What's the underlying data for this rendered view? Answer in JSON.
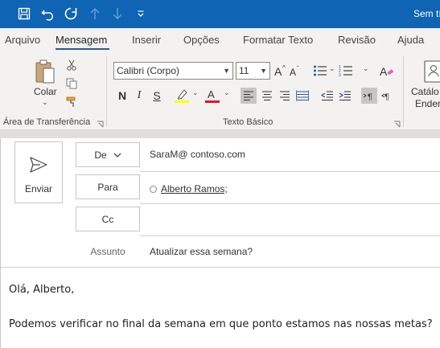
{
  "window": {
    "title": "Sem tí"
  },
  "quick_access": {
    "icons": [
      "save-icon",
      "undo-icon",
      "redo-icon",
      "arrow-up-icon",
      "arrow-down-icon",
      "customize-icon"
    ]
  },
  "tabs": [
    {
      "label": "Arquivo",
      "active": false
    },
    {
      "label": "Mensagem",
      "active": true
    },
    {
      "label": "Inserir",
      "active": false
    },
    {
      "label": "Opções",
      "active": false
    },
    {
      "label": "Formatar Texto",
      "active": false
    },
    {
      "label": "Revisão",
      "active": false
    },
    {
      "label": "Ajuda",
      "active": false
    }
  ],
  "ribbon": {
    "clipboard": {
      "paste_label": "Colar",
      "group_label": "Área de Transferência"
    },
    "basic_text": {
      "font_name": "Calibri (Corpo)",
      "font_size": "11",
      "bold_label": "N",
      "italic_label": "I",
      "underline_label": "S",
      "highlight_color": "#ffff00",
      "font_color": "#e81123",
      "group_label": "Texto Básico"
    },
    "address_book": {
      "label_line1": "Catálo",
      "label_line2": "Ender"
    }
  },
  "compose": {
    "send_label": "Enviar",
    "from_label": "De",
    "from_value": "SaraM@ contoso.com",
    "to_label": "Para",
    "to_recipient": "Alberto Ramos;",
    "cc_label": "Cc",
    "subject_label": "Assunto",
    "subject_value": "Atualizar essa semana?"
  },
  "body": {
    "greeting": "Olá, Alberto,",
    "line1": "Podemos verificar no final da semana em que ponto estamos nas nossas metas?"
  },
  "colors": {
    "titlebar": "#0f64b4",
    "accent": "#2b579a",
    "ribbon_bg": "#f3f2f1"
  }
}
